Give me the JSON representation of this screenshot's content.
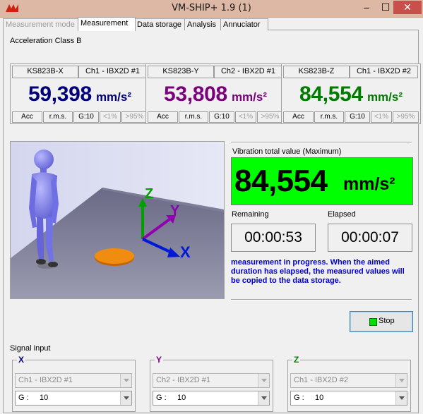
{
  "window": {
    "title": "VM-SHIP+ 1.9 (1)",
    "minimize": "–",
    "maximize": "☐",
    "close": "✕"
  },
  "tabs": [
    {
      "label": "Measurement mode",
      "state": "disabled"
    },
    {
      "label": "Measurement",
      "state": "active"
    },
    {
      "label": "Data storage",
      "state": "normal"
    },
    {
      "label": "Analysis",
      "state": "normal"
    },
    {
      "label": "Annuciator",
      "state": "normal"
    }
  ],
  "acceleration_class": "Acceleration Class B",
  "channels": [
    {
      "sensor": "KS823B-X",
      "channel": "Ch1 - IBX2D #1",
      "value": "59,398",
      "unit": "mm/s²",
      "color": "#00007b",
      "footer": [
        "Acc",
        "r.m.s.",
        "G:10",
        "<1%",
        ">95%"
      ]
    },
    {
      "sensor": "KS823B-Y",
      "channel": "Ch2 - IBX2D #1",
      "value": "53,808",
      "unit": "mm/s²",
      "color": "#7b007b",
      "footer": [
        "Acc",
        "r.m.s.",
        "G:10",
        "<1%",
        ">95%"
      ]
    },
    {
      "sensor": "KS823B-Z",
      "channel": "Ch1 - IBX2D #2",
      "value": "84,554",
      "unit": "mm/s²",
      "color": "#007b00",
      "footer": [
        "Acc",
        "r.m.s.",
        "G:10",
        "<1%",
        ">95%"
      ]
    }
  ],
  "scene": {
    "axis_x": "X",
    "axis_y": "Y",
    "axis_z": "Z",
    "icon": "human-figure-3d-icon"
  },
  "vibration": {
    "label": "Vibration total value (Maximum)",
    "value": "84,554",
    "unit": "mm/s²",
    "bg": "#00ff00"
  },
  "timers": {
    "remaining_label": "Remaining",
    "remaining": "00:00:53",
    "elapsed_label": "Elapsed",
    "elapsed": "00:00:07"
  },
  "message": "measurement in progress. When the aimed duration has elapsed, the measured values will be copied to the data storage.",
  "stop_button": "Stop",
  "signal_input": {
    "label": "Signal input",
    "groups": [
      {
        "axis": "X",
        "axis_color": "#000080",
        "channel": "Ch1 - IBX2D #1",
        "gain_label": "G :",
        "gain": "10"
      },
      {
        "axis": "Y",
        "axis_color": "#800080",
        "channel": "Ch2 - IBX2D #1",
        "gain_label": "G :",
        "gain": "10"
      },
      {
        "axis": "Z",
        "axis_color": "#008000",
        "channel": "Ch1 - IBX2D #2",
        "gain_label": "G :",
        "gain": "10"
      }
    ]
  }
}
